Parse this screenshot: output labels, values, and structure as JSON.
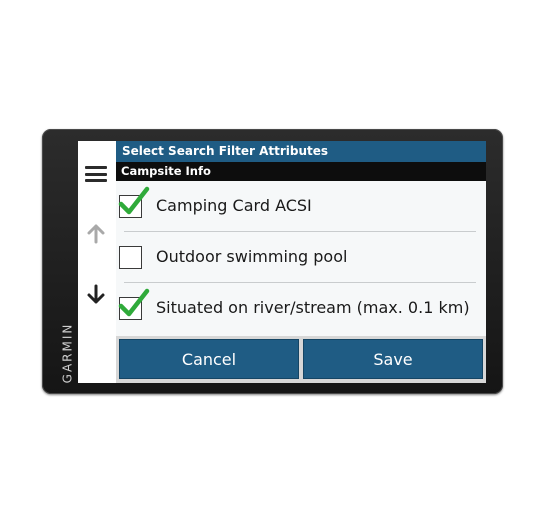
{
  "device": {
    "brand": "GARMIN"
  },
  "sidebar": {
    "menu_icon": "hamburger-menu-icon",
    "up_icon": "arrow-up-icon",
    "down_icon": "arrow-down-icon"
  },
  "header": {
    "title": "Select Search Filter Attributes",
    "subtitle": "Campsite Info"
  },
  "options": [
    {
      "label": "Camping Card ACSI",
      "checked": true
    },
    {
      "label": "Outdoor swimming pool",
      "checked": false
    },
    {
      "label": "Situated on river/stream (max. 0.1 km)",
      "checked": true
    }
  ],
  "buttons": {
    "cancel": "Cancel",
    "save": "Save"
  },
  "colors": {
    "title_bar": "#1f5c84",
    "subtitle_bar": "#0d0d0d",
    "button": "#1f5c84",
    "check": "#2faa3a"
  }
}
